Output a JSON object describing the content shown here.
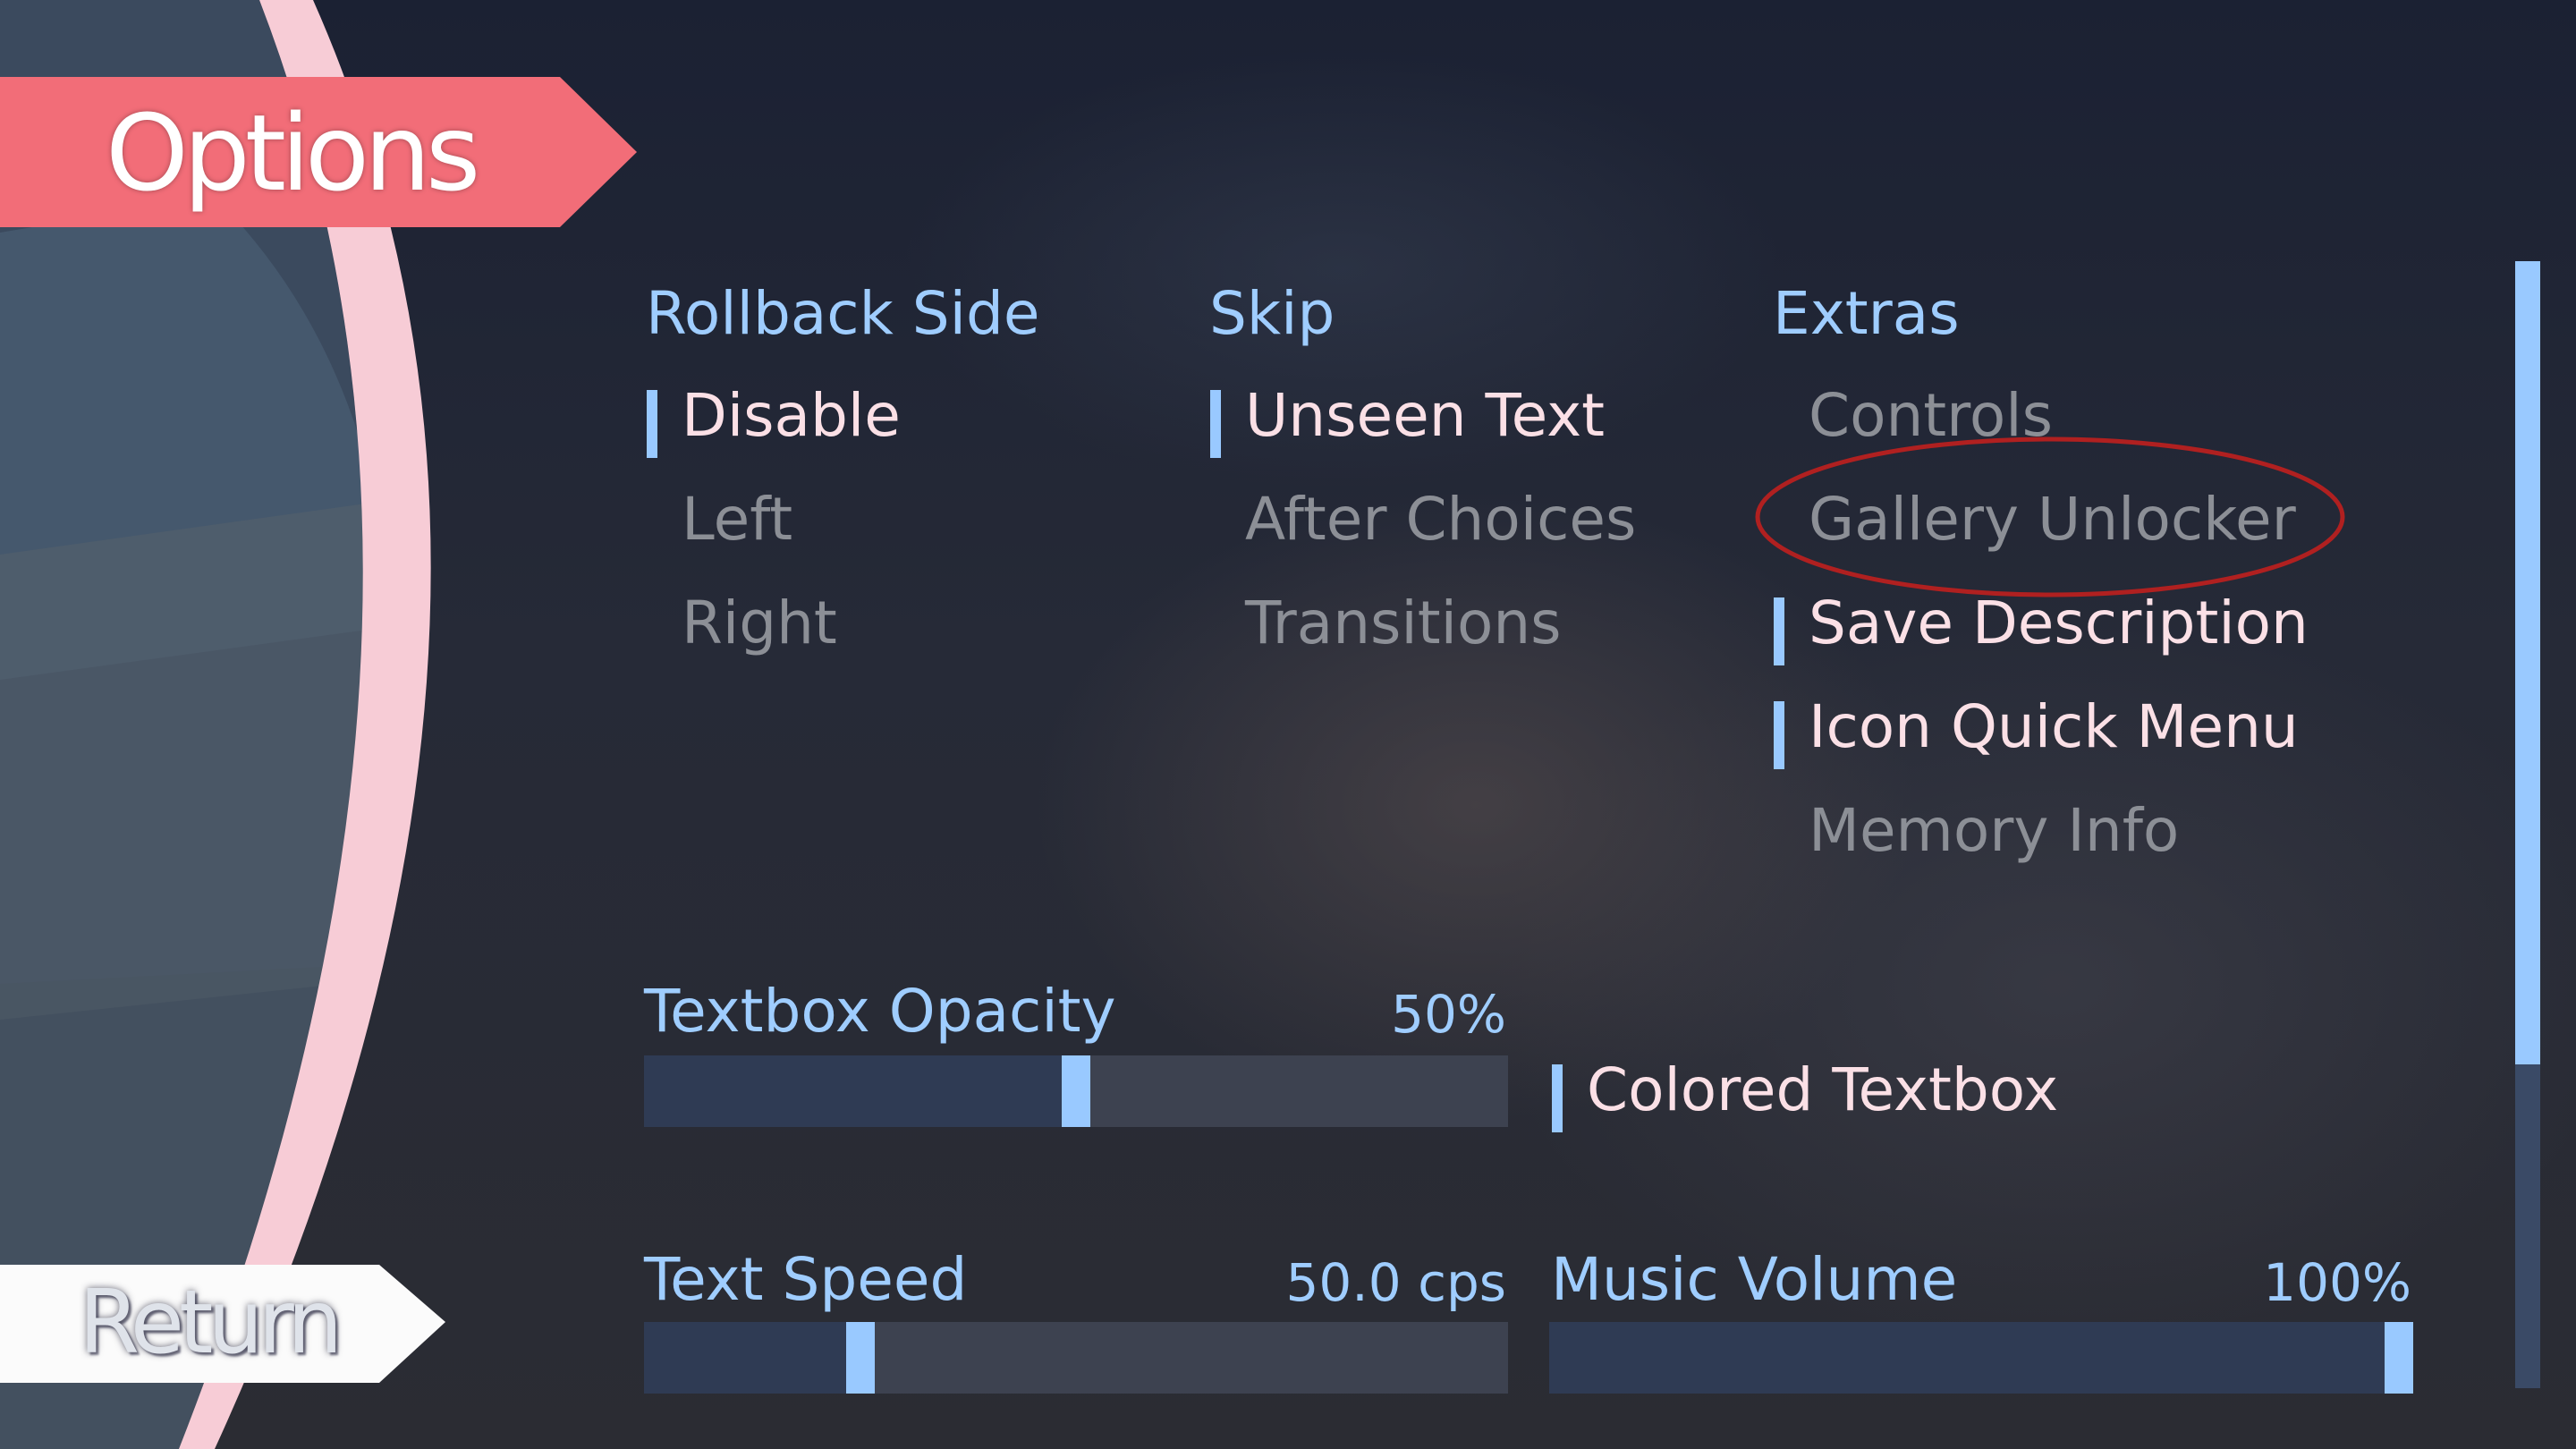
{
  "title": "Options",
  "return_label": "Return",
  "columns": {
    "rollback": {
      "header": "Rollback Side",
      "items": [
        {
          "label": "Disable",
          "selected": true
        },
        {
          "label": "Left",
          "selected": false
        },
        {
          "label": "Right",
          "selected": false
        }
      ]
    },
    "skip": {
      "header": "Skip",
      "items": [
        {
          "label": "Unseen Text",
          "selected": true
        },
        {
          "label": "After Choices",
          "selected": false
        },
        {
          "label": "Transitions",
          "selected": false
        }
      ]
    },
    "extras": {
      "header": "Extras",
      "items": [
        {
          "label": "Controls",
          "selected": false
        },
        {
          "label": "Gallery Unlocker",
          "selected": false
        },
        {
          "label": "Save Description",
          "selected": true
        },
        {
          "label": "Icon Quick Menu",
          "selected": true
        },
        {
          "label": "Memory Info",
          "selected": false
        }
      ]
    }
  },
  "sliders": {
    "textbox_opacity": {
      "label": "Textbox Opacity",
      "value": "50%",
      "fraction": 0.5
    },
    "text_speed": {
      "label": "Text Speed",
      "value": "50.0 cps",
      "fraction": 0.25
    },
    "music_volume": {
      "label": "Music Volume",
      "value": "100%",
      "fraction": 1.0
    }
  },
  "toggles": {
    "colored_textbox": {
      "label": "Colored Textbox",
      "selected": true
    }
  },
  "colors": {
    "accent_blue": "#99c9ff",
    "banner_pink": "#f26d78",
    "selected_text": "#fbe0e6",
    "unselected_text": "#8c8f96",
    "annotation_red": "#b02020"
  }
}
